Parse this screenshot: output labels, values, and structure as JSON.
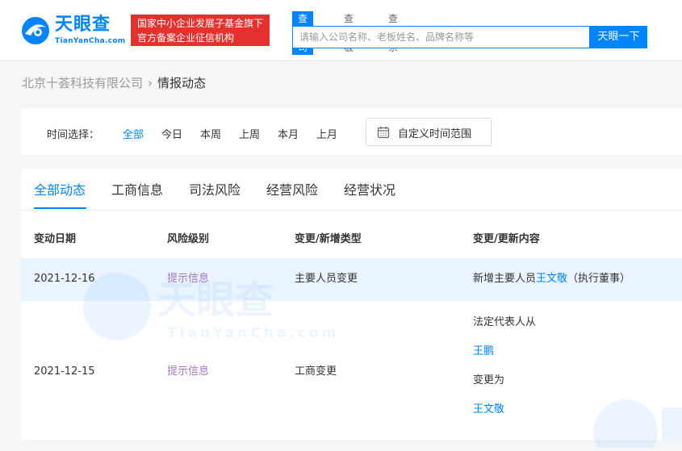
{
  "header": {
    "logo": {
      "cn": "天眼查",
      "en": "TianYanCha.com"
    },
    "badge": {
      "line1": "国家中小企业发展子基金旗下",
      "line2": "官方备案企业征信机构"
    },
    "search_tabs": [
      "查公司",
      "查老板",
      "查关系"
    ],
    "search_placeholder": "请输入公司名称、老板姓名、品牌名称等",
    "search_button": "天眼一下"
  },
  "breadcrumb": {
    "company": "北京十荟科技有限公司",
    "separator": "›",
    "current": "情报动态"
  },
  "filter": {
    "label": "时间选择：",
    "options": [
      "全部",
      "今日",
      "本周",
      "上周",
      "本月",
      "上月"
    ],
    "active_option": "全部",
    "custom_range": "自定义时间范围"
  },
  "tabs": {
    "items": [
      "全部动态",
      "工商信息",
      "司法风险",
      "经营风险",
      "经营状况"
    ],
    "active": "全部动态"
  },
  "table": {
    "headers": [
      "变动日期",
      "风险级别",
      "变更/新增类型",
      "变更/更新内容"
    ],
    "rows": [
      {
        "date": "2021-12-16",
        "risk": "提示信息",
        "type": "主要人员变更",
        "content_prefix": "新增主要人员",
        "content_person": "王文敬",
        "content_suffix": "（执行董事）"
      },
      {
        "date": "2021-12-15",
        "risk": "提示信息",
        "type": "工商变更",
        "content_line1": "法定代表人从",
        "content_from": "王鹏",
        "content_line3": "变更为",
        "content_to": "王文敬"
      }
    ]
  },
  "colors": {
    "brand": "#0084ff",
    "badge_red": "#e5312d",
    "risk_purple": "#a276c5",
    "row_highlight": "#eaf4ff"
  },
  "watermark": {
    "cn": "天眼查",
    "en": "TianYanCha.com"
  }
}
